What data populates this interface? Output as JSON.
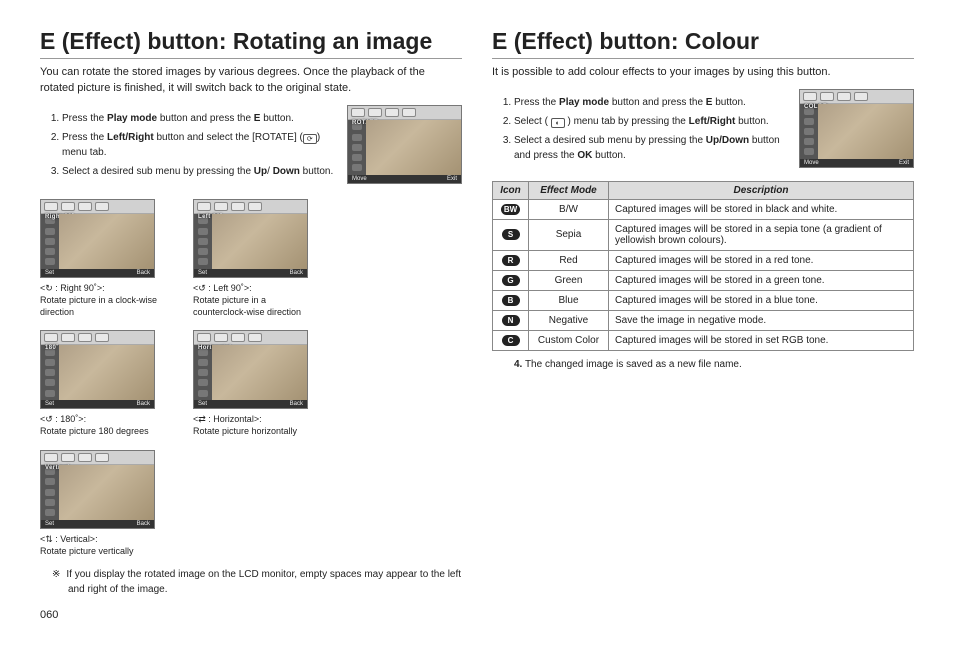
{
  "page_number": "060",
  "left": {
    "title": "E (Effect) button: Rotating an image",
    "intro": "You can rotate the stored images by various degrees.\nOnce the playback of the rotated picture is finished, it will switch back to the original state.",
    "steps": [
      {
        "pre": "Press the ",
        "b1": "Play mode",
        "mid": " button and press the ",
        "b2": "E",
        "post": " button."
      },
      {
        "pre": "Press the ",
        "b1": "Left/Right",
        "mid": " button and select the [ROTATE] (",
        "icon": "rotate-icon",
        "post2": ") menu tab."
      },
      {
        "pre": "Select a desired sub menu by pressing the ",
        "b1": "Up",
        "mid": "/ ",
        "b2": "Down",
        "post": " button."
      }
    ],
    "lcd_main": {
      "label": "ROTATE",
      "bl": "Move",
      "br": "Exit"
    },
    "thumbs": [
      {
        "label": "Right 90˚",
        "caption_head": "<↻ : Right 90˚>:",
        "caption": "Rotate picture in a clock-wise direction",
        "bl": "Set",
        "br": "Back"
      },
      {
        "label": "Left 90˚",
        "caption_head": "<↺ : Left 90˚>:",
        "caption": "Rotate picture in a counterclock-wise direction",
        "bl": "Set",
        "br": "Back"
      },
      {
        "label": "180˚",
        "caption_head": "<↺ : 180˚>:",
        "caption": "Rotate picture 180 degrees",
        "bl": "Set",
        "br": "Back"
      },
      {
        "label": "Horizontal",
        "caption_head": "<⇄ : Horizontal>:",
        "caption": "Rotate picture horizontally",
        "bl": "Set",
        "br": "Back"
      },
      {
        "label": "Vertical",
        "caption_head": "<⇅ : Vertical>:",
        "caption": "Rotate picture vertically",
        "bl": "Set",
        "br": "Back"
      }
    ],
    "note": "If you display the rotated image on the LCD monitor, empty spaces may appear to the left and right of the image."
  },
  "right": {
    "title": "E (Effect) button: Colour",
    "intro": "It is possible to add colour effects to your images by using this button.",
    "steps": [
      {
        "pre": "Press the ",
        "b1": "Play mode",
        "mid": " button and press the ",
        "b2": "E",
        "post": " button."
      },
      {
        "pre": "Select ( ",
        "icon": "palette-icon",
        "mid2": " ) menu tab by pressing the ",
        "b1": "Left/Right",
        "post": " button."
      },
      {
        "pre": "Select a desired sub menu by pressing the ",
        "b1": "Up/Down",
        "mid": " button and press the ",
        "b2": "OK",
        "post": " button."
      }
    ],
    "lcd_main": {
      "label": "COLOR",
      "bl": "Move",
      "br": "Exit"
    },
    "table": {
      "headers": {
        "icon": "Icon",
        "mode": "Effect Mode",
        "desc": "Description"
      },
      "rows": [
        {
          "icon_name": "bw-icon",
          "icon_text": "BW",
          "mode": "B/W",
          "desc": "Captured images will be stored in black and white."
        },
        {
          "icon_name": "sepia-icon",
          "icon_text": "S",
          "mode": "Sepia",
          "desc": "Captured images will be stored in a sepia tone (a gradient of yellowish brown colours)."
        },
        {
          "icon_name": "red-icon",
          "icon_text": "R",
          "mode": "Red",
          "desc": "Captured images will be stored in a red tone."
        },
        {
          "icon_name": "green-icon",
          "icon_text": "G",
          "mode": "Green",
          "desc": "Captured images will be stored in a green tone."
        },
        {
          "icon_name": "blue-icon",
          "icon_text": "B",
          "mode": "Blue",
          "desc": "Captured images will be stored in a blue tone."
        },
        {
          "icon_name": "negative-icon",
          "icon_text": "N",
          "mode": "Negative",
          "desc": "Save the image in negative mode."
        },
        {
          "icon_name": "custom-icon",
          "icon_text": "C",
          "mode": "Custom Color",
          "desc": "Captured images will be stored in set RGB tone."
        }
      ]
    },
    "followup": {
      "num": "4.",
      "text": "The changed image is saved as a new file name."
    }
  }
}
